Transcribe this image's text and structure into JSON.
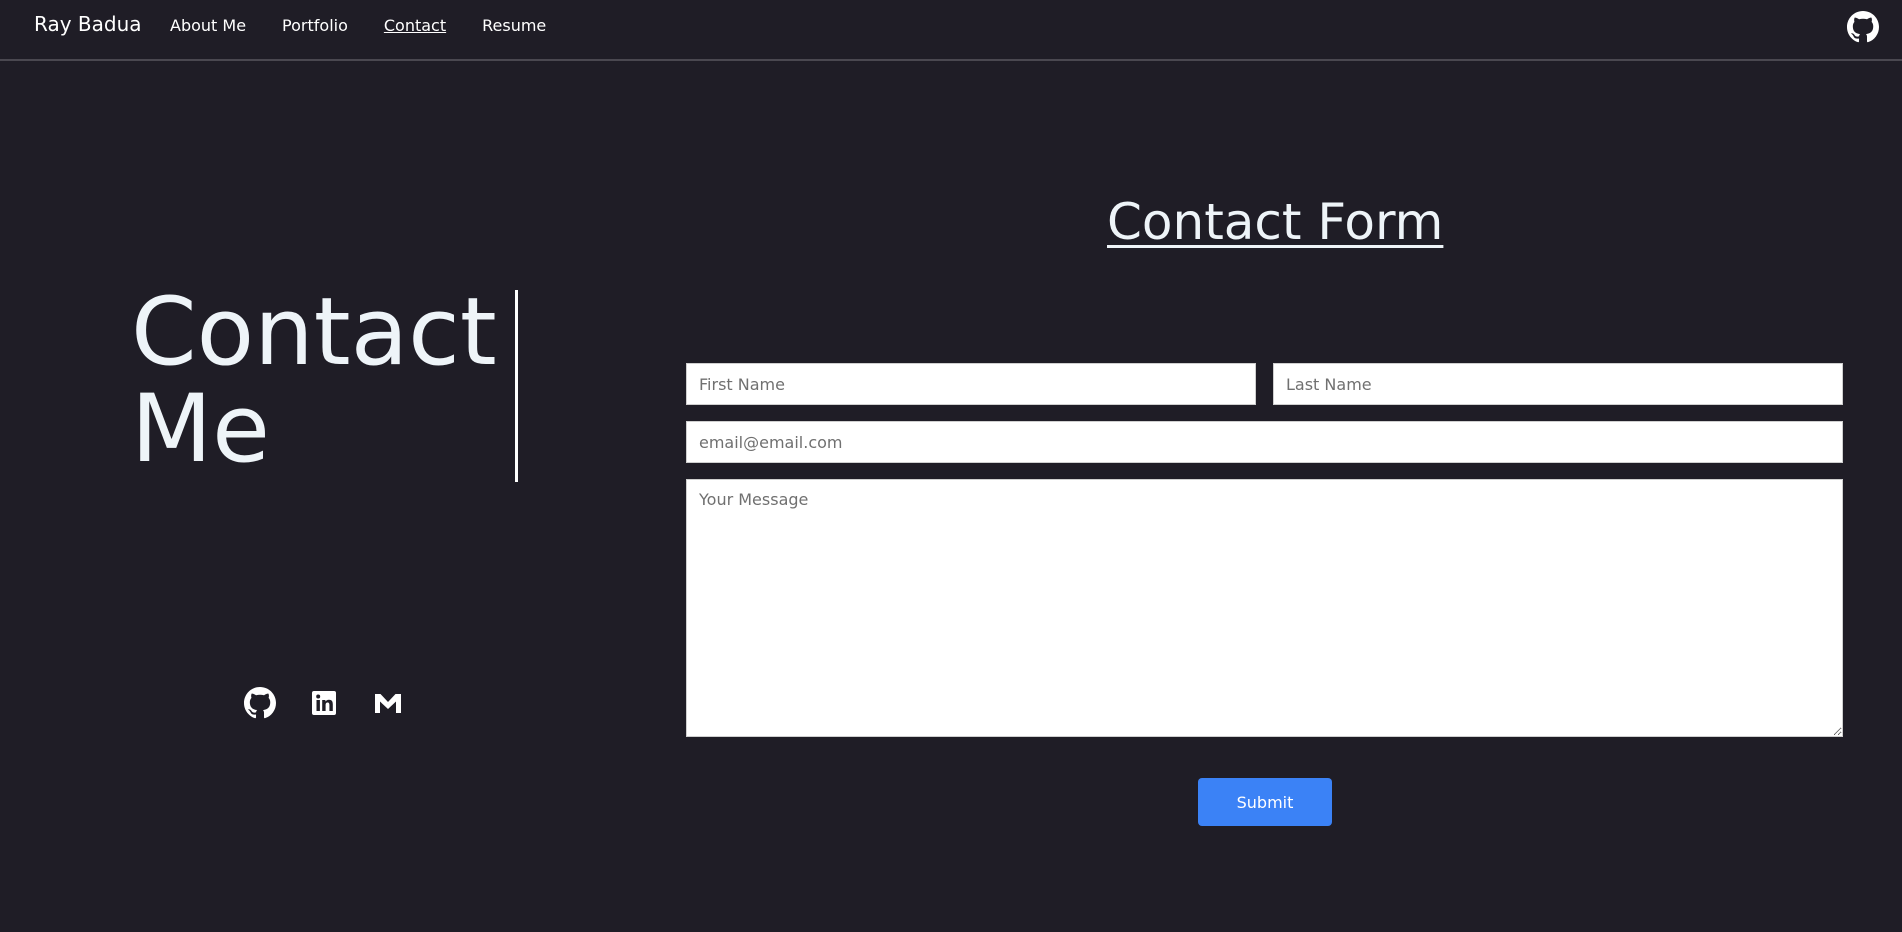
{
  "navbar": {
    "brand": "Ray Badua",
    "links": [
      {
        "label": "About Me",
        "active": false
      },
      {
        "label": "Portfolio",
        "active": false
      },
      {
        "label": "Contact",
        "active": true
      },
      {
        "label": "Resume",
        "active": false
      }
    ],
    "right_icon": "github-icon"
  },
  "hero": {
    "title_line1": "Contact",
    "title_line2": "Me"
  },
  "social": {
    "icons": [
      "github-icon",
      "linkedin-icon",
      "gmail-icon"
    ]
  },
  "form": {
    "title": "Contact Form",
    "first_name_placeholder": "First Name",
    "last_name_placeholder": "Last Name",
    "email_placeholder": "email@email.com",
    "message_placeholder": "Your Message",
    "submit_label": "Submit"
  },
  "colors": {
    "background": "#1f1d26",
    "accent": "#3b82f6",
    "text": "#ffffff"
  }
}
